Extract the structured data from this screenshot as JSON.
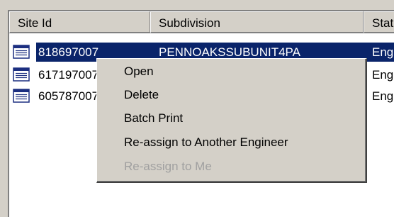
{
  "columns": [
    {
      "label": "Site Id"
    },
    {
      "label": "Subdivision"
    },
    {
      "label": "Status"
    }
  ],
  "rows": [
    {
      "site_id": "818697007",
      "subdivision": "PENNOAKSSUBUNIT4PA",
      "status": "Engineer",
      "selected": true,
      "icon": "document-list-icon"
    },
    {
      "site_id": "617197007",
      "subdivision": "",
      "status": "Engineer",
      "selected": false,
      "icon": "document-list-icon"
    },
    {
      "site_id": "605787007",
      "subdivision": "",
      "status": "Engineer",
      "selected": false,
      "icon": "document-list-icon"
    }
  ],
  "context_menu": {
    "items": [
      {
        "label": "Open",
        "enabled": true
      },
      {
        "label": "Delete",
        "enabled": true
      },
      {
        "label": "Batch Print",
        "enabled": true
      },
      {
        "label": "Re-assign to Another Engineer",
        "enabled": true
      },
      {
        "label": "Re-assign to Me",
        "enabled": false
      }
    ]
  },
  "colors": {
    "selection": "#0a246a",
    "face": "#d4d0c8",
    "disabled_text": "#a0a0a0"
  }
}
